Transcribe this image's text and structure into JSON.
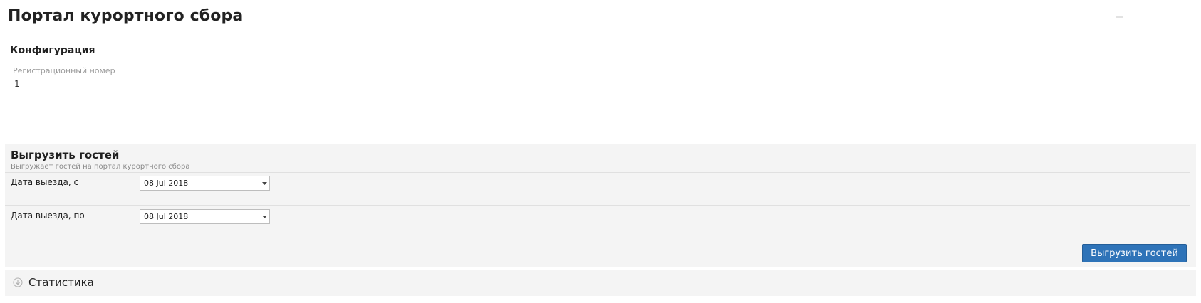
{
  "page": {
    "title": "Портал курортного сбора"
  },
  "config": {
    "title": "Конфигурация",
    "reg_number_label": "Регистрационный номер",
    "reg_number_value": "1"
  },
  "export": {
    "title": "Выгрузить гостей",
    "subtitle": "Выгружает гостей на портал курортного сбора",
    "date_from_label": "Дата выезда, с",
    "date_from_value": "08 Jul 2018",
    "date_to_label": "Дата выезда, по",
    "date_to_value": "08 Jul 2018",
    "button_label": "Выгрузить гостей"
  },
  "stats": {
    "title": "Статистика"
  },
  "colors": {
    "button_bg": "#2e73b8",
    "panel_bg": "#f4f4f4"
  },
  "icons": {
    "dropdown": "chevron-down-icon",
    "expand": "expand-circle-icon"
  }
}
